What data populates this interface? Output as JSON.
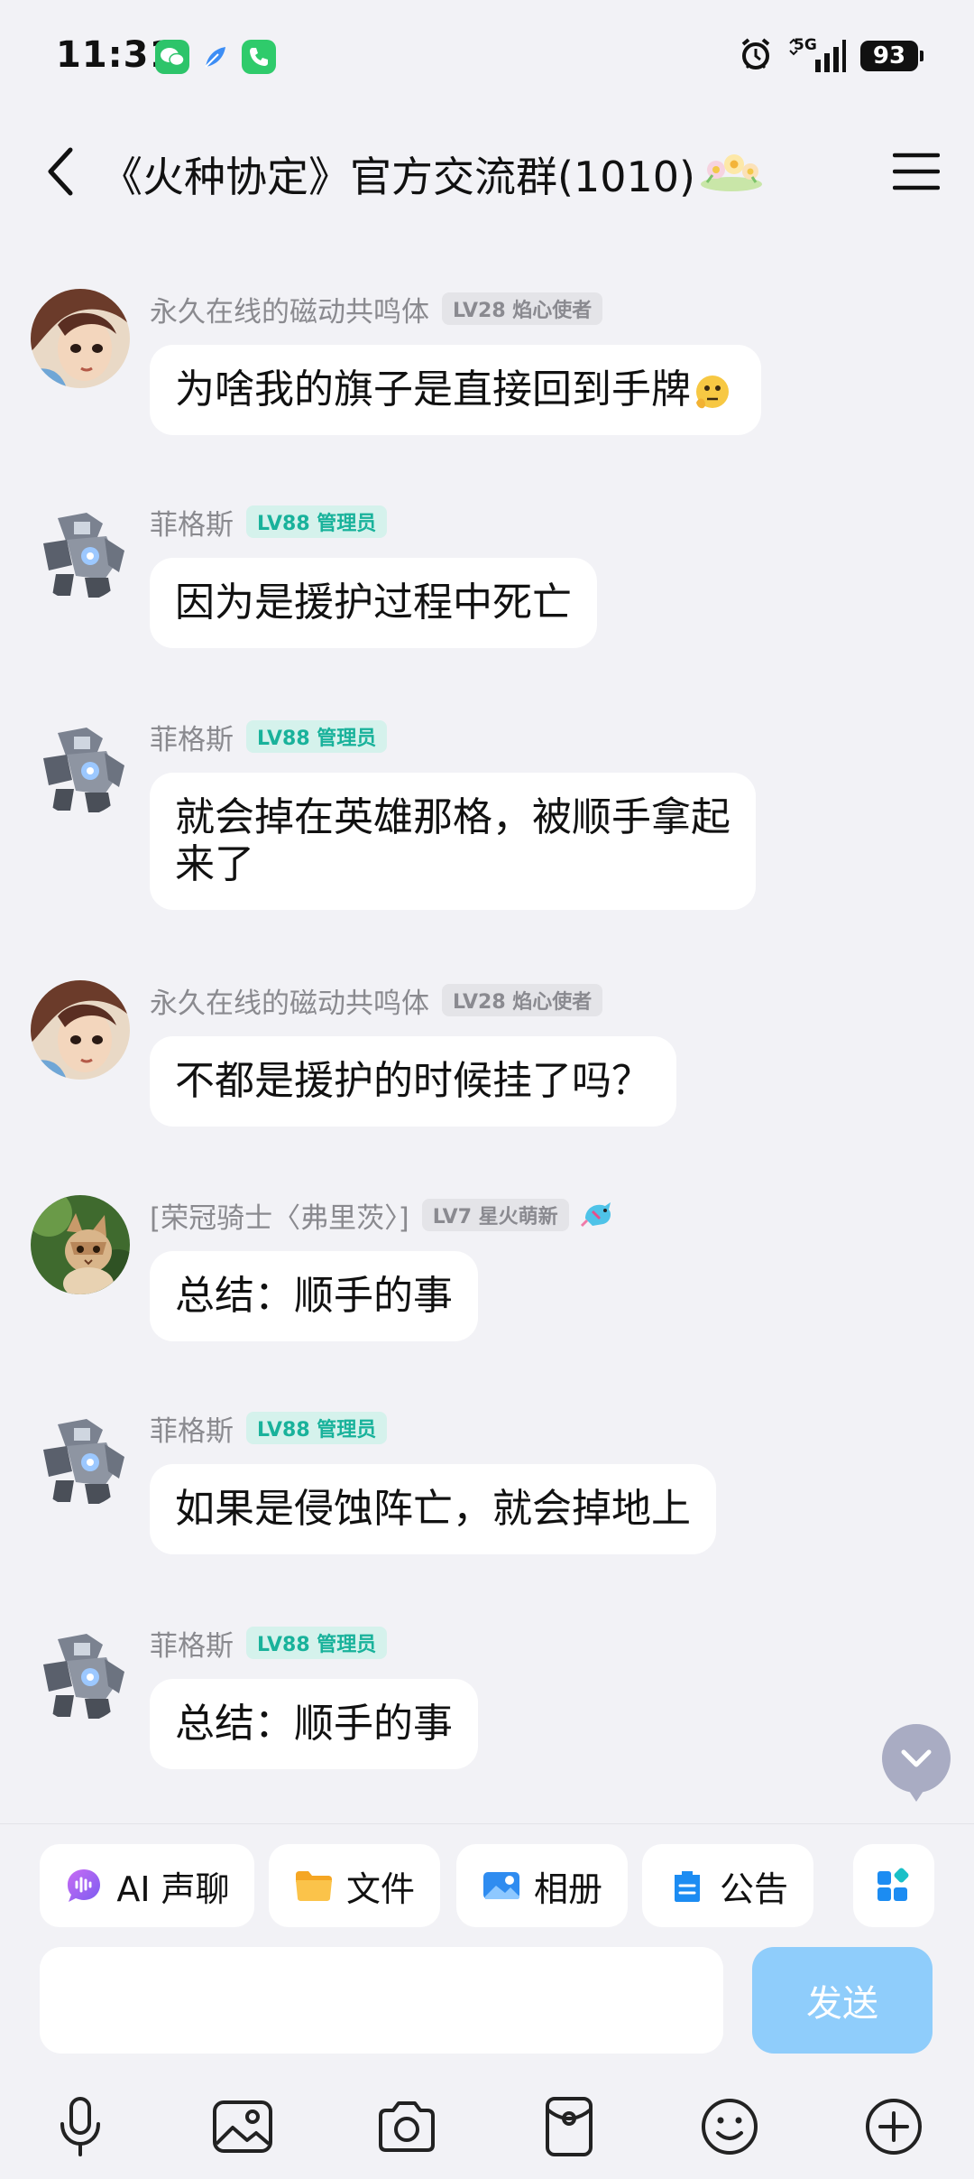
{
  "status_bar": {
    "time": "11:31",
    "network": "5G",
    "battery": "93"
  },
  "header": {
    "title": "《火种协定》官方交流群(1010)"
  },
  "messages": [
    {
      "sender": "永久在线的磁动共鸣体",
      "badge": "LV28 焰心使者",
      "badge_style": "grey",
      "text": "为啥我的旗子是直接回到手牌"
    },
    {
      "sender": "菲格斯",
      "badge": "LV88 管理员",
      "badge_style": "green",
      "text": "因为是援护过程中死亡"
    },
    {
      "sender": "菲格斯",
      "badge": "LV88 管理员",
      "badge_style": "green",
      "text_line1": "就会掉在英雄那格，被顺手拿起",
      "text_line2": "来了"
    },
    {
      "sender": "永久在线的磁动共鸣体",
      "badge": "LV28 焰心使者",
      "badge_style": "grey",
      "text": "不都是援护的时候挂了吗？"
    },
    {
      "sender": "[荣冠骑士〈弗里茨〉]",
      "badge": "LV7 星火萌新",
      "badge_style": "grey",
      "text": "总结：顺手的事"
    },
    {
      "sender": "菲格斯",
      "badge": "LV88 管理员",
      "badge_style": "green",
      "text": "如果是侵蚀阵亡，就会掉地上"
    },
    {
      "sender": "菲格斯",
      "badge": "LV88 管理员",
      "badge_style": "green",
      "text": "总结：顺手的事"
    }
  ],
  "quick_actions": {
    "ai_voice": "AI 声聊",
    "files": "文件",
    "album": "相册",
    "notice": "公告"
  },
  "composer": {
    "send_label": "发送"
  },
  "colors": {
    "background": "#f2f2f6",
    "admin_badge_bg": "#d5f2ec",
    "admin_badge_text": "#19b29b",
    "level_badge_bg": "#e4e4e8",
    "send_button": "#8fcdfb"
  }
}
